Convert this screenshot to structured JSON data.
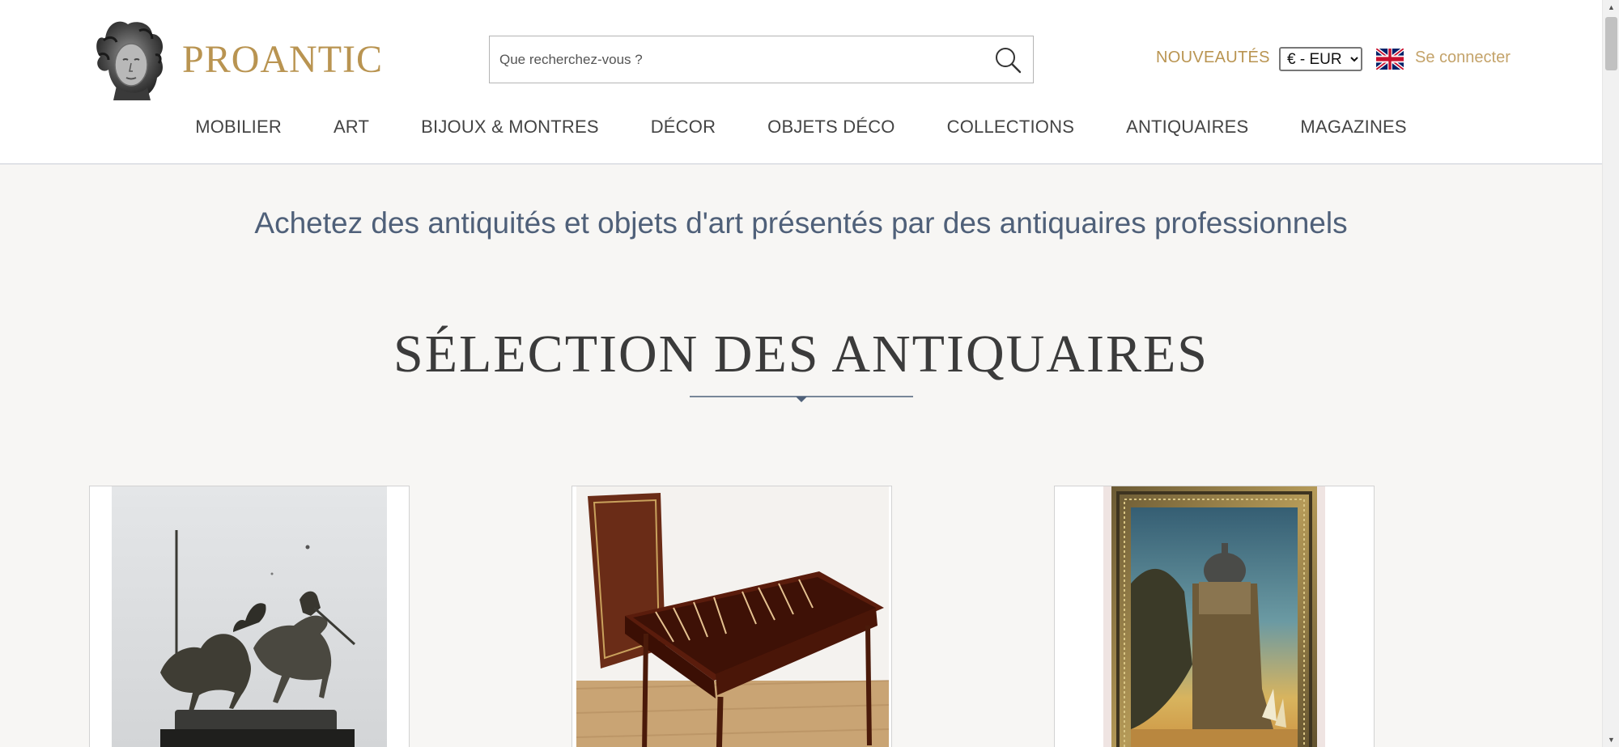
{
  "header": {
    "logo_text": "PROANTIC",
    "search": {
      "placeholder": "Que recherchez-vous ?",
      "value": ""
    },
    "new_link": "NOUVEAUTÉS",
    "currency": {
      "selected": "€ - EUR",
      "options": [
        "€ - EUR"
      ]
    },
    "language_icon": "uk-flag-icon",
    "login_link": "Se connecter"
  },
  "nav": {
    "items": [
      {
        "label": "MOBILIER"
      },
      {
        "label": "ART"
      },
      {
        "label": "BIJOUX & MONTRES"
      },
      {
        "label": "DÉCOR"
      },
      {
        "label": "OBJETS DÉCO"
      },
      {
        "label": "COLLECTIONS"
      },
      {
        "label": "ANTIQUAIRES"
      },
      {
        "label": "MAGAZINES"
      }
    ]
  },
  "main": {
    "tagline": "Achetez des antiquités et objets d'art présentés par des antiquaires professionnels",
    "section_title": "SÉLECTION DES ANTIQUAIRES",
    "cards": [
      {
        "image": "bronze-horsemen-sculpture"
      },
      {
        "image": "backgammon-games-table"
      },
      {
        "image": "framed-orientalist-painting"
      }
    ]
  },
  "colors": {
    "brand_gold": "#b99451",
    "link_gold": "#c4a36a",
    "tagline_blue": "#4f6079",
    "page_bg": "#f7f6f4"
  }
}
